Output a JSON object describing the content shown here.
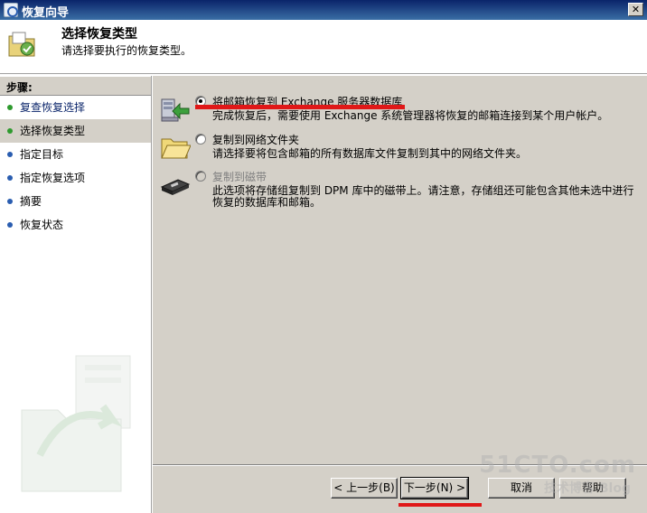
{
  "window": {
    "title": "恢复向导"
  },
  "header": {
    "title": "选择恢复类型",
    "subtitle": "请选择要执行的恢复类型。"
  },
  "sidebar": {
    "heading": "步骤:",
    "items": [
      {
        "label": "复查恢复选择",
        "dot_color": "#2e9a2e"
      },
      {
        "label": "选择恢复类型",
        "dot_color": "#2e9a2e"
      },
      {
        "label": "指定目标",
        "dot_color": "#2a5db0"
      },
      {
        "label": "指定恢复选项",
        "dot_color": "#2a5db0"
      },
      {
        "label": "摘要",
        "dot_color": "#2a5db0"
      },
      {
        "label": "恢复状态",
        "dot_color": "#2a5db0"
      }
    ]
  },
  "options": [
    {
      "label": "将邮箱恢复到 Exchange 服务器数据库",
      "description": "完成恢复后，需要使用 Exchange 系统管理器将恢复的邮箱连接到某个用户帐户。",
      "icon": "server-restore-icon",
      "checked": true,
      "enabled": true
    },
    {
      "label": "复制到网络文件夹",
      "description": "请选择要将包含邮箱的所有数据库文件复制到其中的网络文件夹。",
      "icon": "folder-icon",
      "checked": false,
      "enabled": true
    },
    {
      "label": "复制到磁带",
      "description": "此选项将存储组复制到 DPM 库中的磁带上。请注意，存储组还可能包含其他未选中进行恢复的数据库和邮箱。",
      "icon": "tape-icon",
      "checked": false,
      "enabled": false
    }
  ],
  "buttons": {
    "back": "< 上一步(B)",
    "next": "下一步(N) >",
    "cancel": "取消",
    "help": "帮助"
  },
  "watermark": {
    "brand": "51CTO.com",
    "tagline": "技术博客 Blog"
  },
  "colors": {
    "annotation_red": "#e01818",
    "titlebar": "#0a246a",
    "dialog_gray": "#d4d0c8"
  }
}
